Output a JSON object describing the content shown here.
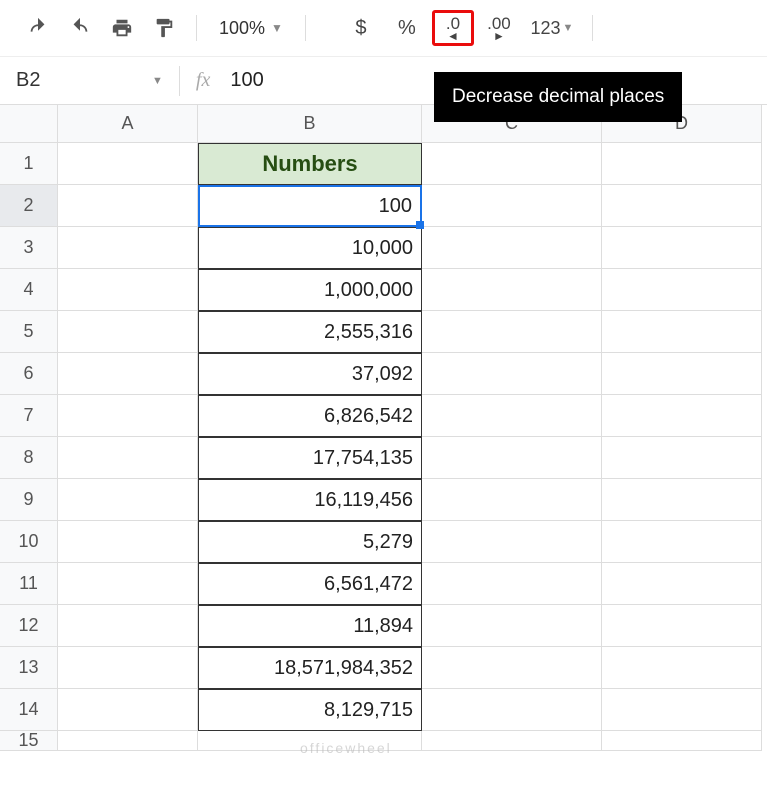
{
  "toolbar": {
    "zoom": "100%",
    "currency": "$",
    "percent": "%",
    "dec_decrease": ".0",
    "dec_increase": ".00",
    "more_formats": "123",
    "tooltip_decrease": "Decrease decimal places"
  },
  "formula_bar": {
    "cell_ref": "B2",
    "fx_label": "fx",
    "value": "100"
  },
  "columns": [
    "A",
    "B",
    "C",
    "D"
  ],
  "rows": [
    "1",
    "2",
    "3",
    "4",
    "5",
    "6",
    "7",
    "8",
    "9",
    "10",
    "11",
    "12",
    "13",
    "14",
    "15"
  ],
  "sheet": {
    "header": "Numbers",
    "values": [
      "100",
      "10,000",
      "1,000,000",
      "2,555,316",
      "37,092",
      "6,826,542",
      "17,754,135",
      "16,119,456",
      "5,279",
      "6,561,472",
      "11,894",
      "18,571,984,352",
      "8,129,715"
    ]
  },
  "selected_row": 2,
  "colors": {
    "highlight_border": "#ea0c0c",
    "selection_blue": "#1a73e8",
    "header_bg": "#d9ead3"
  },
  "watermark": "officewheel"
}
